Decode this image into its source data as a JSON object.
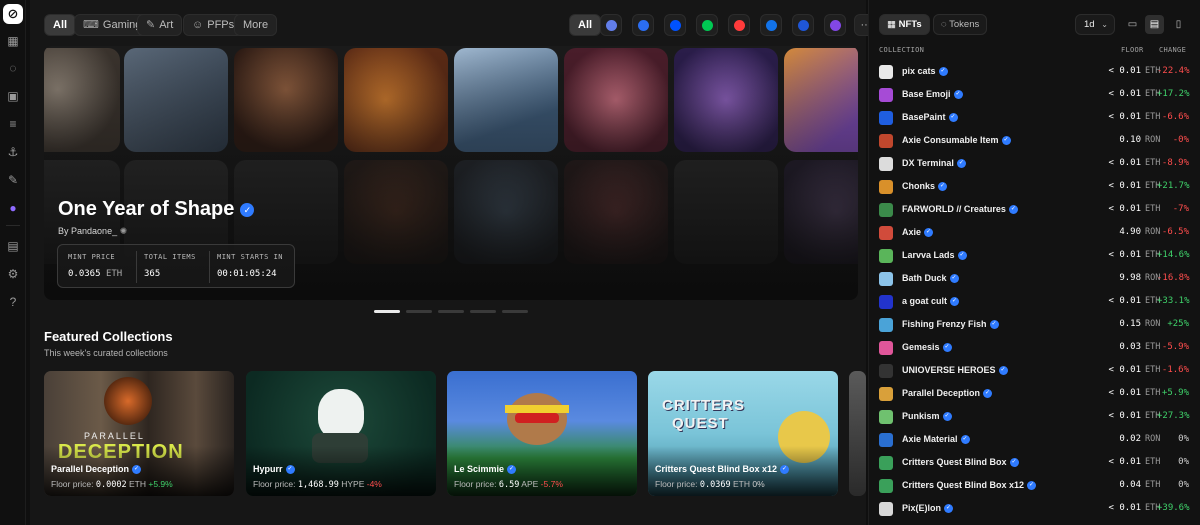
{
  "topbar": {
    "categories": [
      {
        "label": "All",
        "icon": ""
      },
      {
        "label": "Gaming",
        "icon": "gamepad-icon"
      },
      {
        "label": "Art",
        "icon": "brush-icon"
      },
      {
        "label": "PFPs",
        "icon": "face-icon"
      },
      {
        "label": "More",
        "icon": ""
      }
    ],
    "chains_all_label": "All",
    "chains": [
      {
        "name": "ethereum",
        "color": "#627eea"
      },
      {
        "name": "solana",
        "color": "#2b6df0"
      },
      {
        "name": "base",
        "color": "#0052ff"
      },
      {
        "name": "flow",
        "color": "#00c853"
      },
      {
        "name": "apechain",
        "color": "#ff3b3b"
      },
      {
        "name": "ronin",
        "color": "#1273ea"
      },
      {
        "name": "immutable",
        "color": "#1f56d6"
      },
      {
        "name": "polygon",
        "color": "#8247e5"
      }
    ],
    "more_label": "···"
  },
  "hero": {
    "title": "One Year of Shape",
    "by_label": "By",
    "creator": "Pandaone_",
    "stats": [
      {
        "label": "MINT PRICE",
        "value": "0.0365",
        "unit": "ETH"
      },
      {
        "label": "TOTAL ITEMS",
        "value": "365",
        "unit": ""
      },
      {
        "label": "MINT STARTS IN",
        "value": "00:01:05:24",
        "unit": ""
      }
    ],
    "slides": 5,
    "active_slide": 0
  },
  "featured": {
    "title": "Featured Collections",
    "subtitle": "This week's curated collections",
    "cards": [
      {
        "name": "Parallel Deception",
        "floor_label": "Floor price:",
        "floor": "0.0002",
        "currency": "ETH",
        "change": "+5.9%",
        "trend": "up"
      },
      {
        "name": "Hypurr",
        "floor_label": "Floor price:",
        "floor": "1,468.99",
        "currency": "HYPE",
        "change": "-4%",
        "trend": "down"
      },
      {
        "name": "Le Scimmie",
        "floor_label": "Floor price:",
        "floor": "6.59",
        "currency": "APE",
        "change": "-5.7%",
        "trend": "down"
      },
      {
        "name": "Critters Quest Blind Box x12",
        "floor_label": "Floor price:",
        "floor": "0.0369",
        "currency": "ETH",
        "change": "0%",
        "trend": "neutral"
      }
    ],
    "card_art_text": {
      "parallel_word": "PARALLEL",
      "deception_word": "DECEPTION",
      "critters_word": "CRITTERS",
      "quest_word": "QUEST"
    }
  },
  "panel": {
    "tabs": [
      {
        "label": "NFTs",
        "icon": "grid-icon"
      },
      {
        "label": "Tokens",
        "icon": "coin-icon"
      }
    ],
    "timeframe": "1d",
    "headers": {
      "collection": "COLLECTION",
      "floor": "FLOOR",
      "change": "CHANGE"
    },
    "rows": [
      {
        "name": "pix cats",
        "floor": "< 0.01",
        "cur": "ETH",
        "change": "-22.4%",
        "trend": "down",
        "color": "#e9e9e9"
      },
      {
        "name": "Base Emoji",
        "floor": "< 0.01",
        "cur": "ETH",
        "change": "+17.2%",
        "trend": "up",
        "color": "#a64bd6"
      },
      {
        "name": "BasePaint",
        "floor": "< 0.01",
        "cur": "ETH",
        "change": "-6.6%",
        "trend": "down",
        "color": "#1f5ee0"
      },
      {
        "name": "Axie Consumable Item",
        "floor": "0.10",
        "cur": "RON",
        "change": "-0%",
        "trend": "down",
        "color": "#c0472d"
      },
      {
        "name": "DX Terminal",
        "floor": "< 0.01",
        "cur": "ETH",
        "change": "-8.9%",
        "trend": "down",
        "color": "#dcdcdc"
      },
      {
        "name": "Chonks",
        "floor": "< 0.01",
        "cur": "ETH",
        "change": "+21.7%",
        "trend": "up",
        "color": "#d9902a"
      },
      {
        "name": "FARWORLD // Creatures",
        "floor": "< 0.01",
        "cur": "ETH",
        "change": "-7%",
        "trend": "down",
        "color": "#3b8a4a"
      },
      {
        "name": "Axie",
        "floor": "4.90",
        "cur": "RON",
        "change": "-6.5%",
        "trend": "down",
        "color": "#d14b3b"
      },
      {
        "name": "Larvva Lads",
        "floor": "< 0.01",
        "cur": "ETH",
        "change": "+14.6%",
        "trend": "up",
        "color": "#5ab55a"
      },
      {
        "name": "Bath Duck",
        "floor": "9.98",
        "cur": "RON",
        "change": "-16.8%",
        "trend": "down",
        "color": "#8cc4ea"
      },
      {
        "name": "a goat cult",
        "floor": "< 0.01",
        "cur": "ETH",
        "change": "+33.1%",
        "trend": "up",
        "color": "#2233cc"
      },
      {
        "name": "Fishing Frenzy Fish",
        "floor": "0.15",
        "cur": "RON",
        "change": "+25%",
        "trend": "up",
        "color": "#4aa3d8"
      },
      {
        "name": "Gemesis",
        "floor": "0.03",
        "cur": "ETH",
        "change": "-5.9%",
        "trend": "down",
        "color": "#e0569a"
      },
      {
        "name": "UNIOVERSE HEROES",
        "floor": "< 0.01",
        "cur": "ETH",
        "change": "-1.6%",
        "trend": "down",
        "color": "#333333"
      },
      {
        "name": "Parallel Deception",
        "floor": "< 0.01",
        "cur": "ETH",
        "change": "+5.9%",
        "trend": "up",
        "color": "#d9a03a"
      },
      {
        "name": "Punkism",
        "floor": "< 0.01",
        "cur": "ETH",
        "change": "+27.3%",
        "trend": "up",
        "color": "#6fc16f"
      },
      {
        "name": "Axie Material",
        "floor": "0.02",
        "cur": "RON",
        "change": "0%",
        "trend": "neutral",
        "color": "#2a6fd1"
      },
      {
        "name": "Critters Quest Blind Box",
        "floor": "< 0.01",
        "cur": "ETH",
        "change": "0%",
        "trend": "neutral",
        "color": "#3aa05a"
      },
      {
        "name": "Critters Quest Blind Box x12",
        "floor": "0.04",
        "cur": "ETH",
        "change": "0%",
        "trend": "neutral",
        "color": "#3aa05a"
      },
      {
        "name": "Pix(E)lon",
        "floor": "< 0.01",
        "cur": "ETH",
        "change": "+39.6%",
        "trend": "up",
        "color": "#d8d8d8"
      }
    ]
  },
  "colors": {
    "up": "#3fd16a",
    "down": "#ff4d4d",
    "verified": "#2f7bff",
    "accent": "#8f6bff"
  }
}
